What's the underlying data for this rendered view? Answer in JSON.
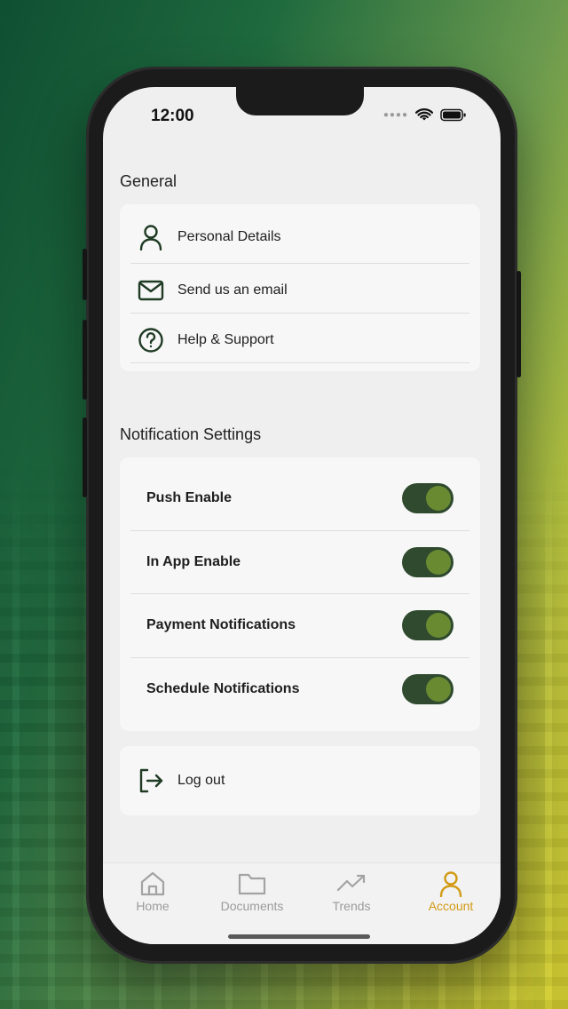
{
  "status_bar": {
    "time": "12:00"
  },
  "general": {
    "title": "General",
    "items": [
      {
        "label": "Personal Details",
        "icon": "person-icon"
      },
      {
        "label": "Send us an email",
        "icon": "mail-icon"
      },
      {
        "label": "Help & Support",
        "icon": "help-icon"
      }
    ]
  },
  "notifications": {
    "title": "Notification Settings",
    "items": [
      {
        "label": "Push Enable",
        "enabled": true
      },
      {
        "label": "In App Enable",
        "enabled": true
      },
      {
        "label": "Payment Notifications",
        "enabled": true
      },
      {
        "label": "Schedule Notifications",
        "enabled": true
      }
    ]
  },
  "logout": {
    "label": "Log out",
    "icon": "logout-icon"
  },
  "tabbar": {
    "tabs": [
      {
        "label": "Home",
        "icon": "home-icon",
        "active": false
      },
      {
        "label": "Documents",
        "icon": "folder-icon",
        "active": false
      },
      {
        "label": "Trends",
        "icon": "trend-icon",
        "active": false
      },
      {
        "label": "Account",
        "icon": "account-icon",
        "active": true
      }
    ]
  },
  "colors": {
    "accent_green": "#2f4a2e",
    "toggle_knob": "#6a8a32",
    "active_tab": "#d29a15",
    "icon_green": "#1f3b24"
  }
}
